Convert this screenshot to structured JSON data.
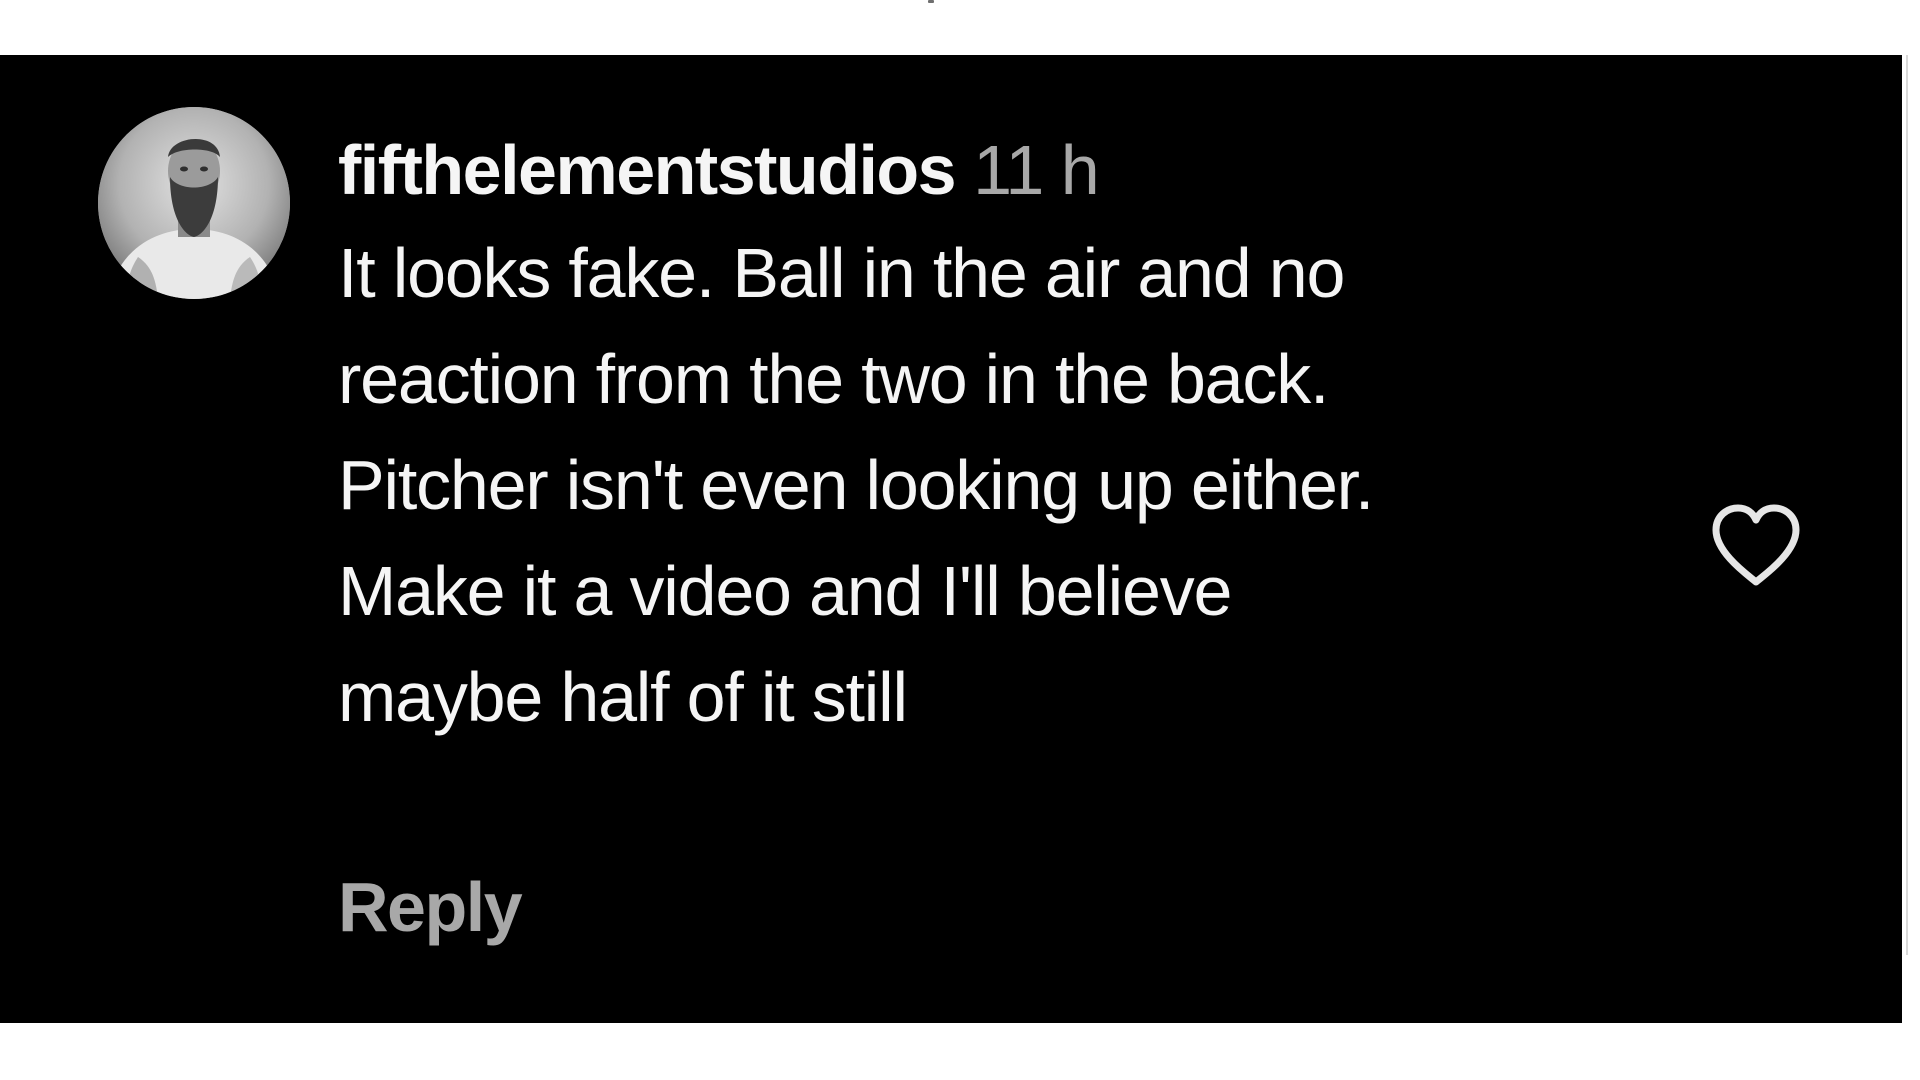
{
  "comment": {
    "username": "fifthelementstudios",
    "timestamp": "11 h",
    "text_lines": [
      "It looks fake. Ball in the air and no",
      "reaction from the two in the back.",
      "Pitcher isn't even looking up either.",
      "Make it a video and I'll believe",
      "maybe half of it still"
    ],
    "reply_label": "Reply",
    "like_icon": "heart-outline-icon"
  },
  "colors": {
    "background": "#000000",
    "text_primary": "#f5f5f5",
    "text_secondary": "#a8a8a8",
    "outer_border": "#ffffff"
  }
}
